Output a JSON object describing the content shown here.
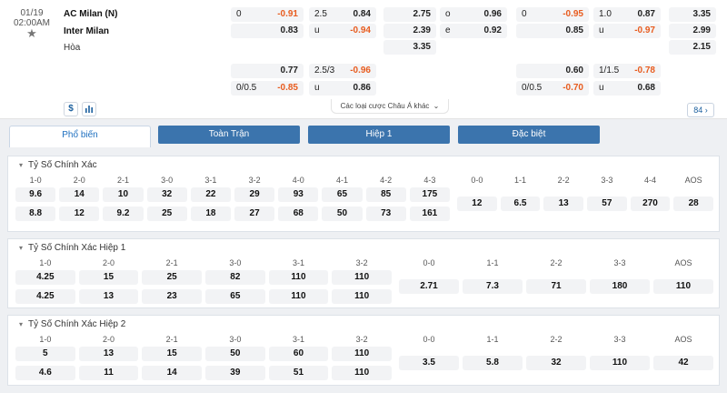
{
  "match": {
    "date": "01/19",
    "time": "02:00AM",
    "home": "AC Milan (N)",
    "away": "Inter Milan",
    "draw": "Hòa"
  },
  "odds_left": {
    "row1": [
      {
        "l": "0",
        "r": "-0.91",
        "r_red": true
      },
      {
        "l": "2.5",
        "r": "0.84",
        "r_red": false
      },
      {
        "l": "",
        "r": "2.75",
        "r_red": false
      },
      {
        "l": "o",
        "r": "0.96",
        "r_red": false
      }
    ],
    "row2": [
      {
        "l": "",
        "r": "0.83",
        "r_red": false
      },
      {
        "l": "u",
        "r": "-0.94",
        "r_red": true
      },
      {
        "l": "",
        "r": "2.39",
        "r_red": false
      },
      {
        "l": "e",
        "r": "0.92",
        "r_red": false
      }
    ],
    "row3": {
      "l": "",
      "r": "3.35"
    },
    "row4": [
      {
        "l": "",
        "r": "0.77",
        "r_red": false
      },
      {
        "l": "2.5/3",
        "r": "-0.96",
        "r_red": true
      }
    ],
    "row5": [
      {
        "l": "0/0.5",
        "r": "-0.85",
        "r_red": true
      },
      {
        "l": "u",
        "r": "0.86",
        "r_red": false
      }
    ]
  },
  "odds_right": {
    "row1": [
      {
        "l": "0",
        "r": "-0.95",
        "r_red": true
      },
      {
        "l": "1.0",
        "r": "0.87",
        "r_red": false
      },
      {
        "l": "",
        "r": "3.35",
        "r_red": false
      }
    ],
    "row2": [
      {
        "l": "",
        "r": "0.85",
        "r_red": false
      },
      {
        "l": "u",
        "r": "-0.97",
        "r_red": true
      },
      {
        "l": "",
        "r": "2.99",
        "r_red": false
      }
    ],
    "row3": {
      "l": "",
      "r": "2.15"
    },
    "row4": [
      {
        "l": "",
        "r": "0.60",
        "r_red": false
      },
      {
        "l": "1/1.5",
        "r": "-0.78",
        "r_red": true
      }
    ],
    "row5": [
      {
        "l": "0/0.5",
        "r": "-0.70",
        "r_red": true
      },
      {
        "l": "u",
        "r": "0.68",
        "r_red": false
      }
    ]
  },
  "toolbar": {
    "dollar_icon": "$",
    "chart_icon": "bar-chart-icon",
    "more_bets": "Các loại cược Châu Á khác",
    "count": "84"
  },
  "tabs": [
    {
      "label": "Phổ biến",
      "active": true
    },
    {
      "label": "Toàn Trận",
      "active": false
    },
    {
      "label": "Hiệp 1",
      "active": false
    },
    {
      "label": "Đặc biệt",
      "active": false
    }
  ],
  "panels": [
    {
      "title": "Tỷ Số Chính Xác",
      "left": [
        {
          "h": "1-0",
          "a": "9.6",
          "b": "8.8"
        },
        {
          "h": "2-0",
          "a": "14",
          "b": "12"
        },
        {
          "h": "2-1",
          "a": "10",
          "b": "9.2"
        },
        {
          "h": "3-0",
          "a": "32",
          "b": "25"
        },
        {
          "h": "3-1",
          "a": "22",
          "b": "18"
        },
        {
          "h": "3-2",
          "a": "29",
          "b": "27"
        },
        {
          "h": "4-0",
          "a": "93",
          "b": "68"
        },
        {
          "h": "4-1",
          "a": "65",
          "b": "50"
        },
        {
          "h": "4-2",
          "a": "85",
          "b": "73"
        },
        {
          "h": "4-3",
          "a": "175",
          "b": "161"
        }
      ],
      "right": [
        {
          "h": "0-0",
          "v": "12"
        },
        {
          "h": "1-1",
          "v": "6.5"
        },
        {
          "h": "2-2",
          "v": "13"
        },
        {
          "h": "3-3",
          "v": "57"
        },
        {
          "h": "4-4",
          "v": "270"
        },
        {
          "h": "AOS",
          "v": "28"
        }
      ]
    },
    {
      "title": "Tỷ Số Chính Xác Hiệp 1",
      "left": [
        {
          "h": "1-0",
          "a": "4.25",
          "b": "4.25"
        },
        {
          "h": "2-0",
          "a": "15",
          "b": "13"
        },
        {
          "h": "2-1",
          "a": "25",
          "b": "23"
        },
        {
          "h": "3-0",
          "a": "82",
          "b": "65"
        },
        {
          "h": "3-1",
          "a": "110",
          "b": "110"
        },
        {
          "h": "3-2",
          "a": "110",
          "b": "110"
        }
      ],
      "right": [
        {
          "h": "0-0",
          "v": "2.71"
        },
        {
          "h": "1-1",
          "v": "7.3"
        },
        {
          "h": "2-2",
          "v": "71"
        },
        {
          "h": "3-3",
          "v": "180"
        },
        {
          "h": "AOS",
          "v": "110"
        }
      ]
    },
    {
      "title": "Tỷ Số Chính Xác Hiệp 2",
      "left": [
        {
          "h": "1-0",
          "a": "5",
          "b": "4.6"
        },
        {
          "h": "2-0",
          "a": "13",
          "b": "11"
        },
        {
          "h": "2-1",
          "a": "15",
          "b": "14"
        },
        {
          "h": "3-0",
          "a": "50",
          "b": "39"
        },
        {
          "h": "3-1",
          "a": "60",
          "b": "51"
        },
        {
          "h": "3-2",
          "a": "110",
          "b": "110"
        }
      ],
      "right": [
        {
          "h": "0-0",
          "v": "3.5"
        },
        {
          "h": "1-1",
          "v": "5.8"
        },
        {
          "h": "2-2",
          "v": "32"
        },
        {
          "h": "3-3",
          "v": "110"
        },
        {
          "h": "AOS",
          "v": "42"
        }
      ]
    }
  ]
}
